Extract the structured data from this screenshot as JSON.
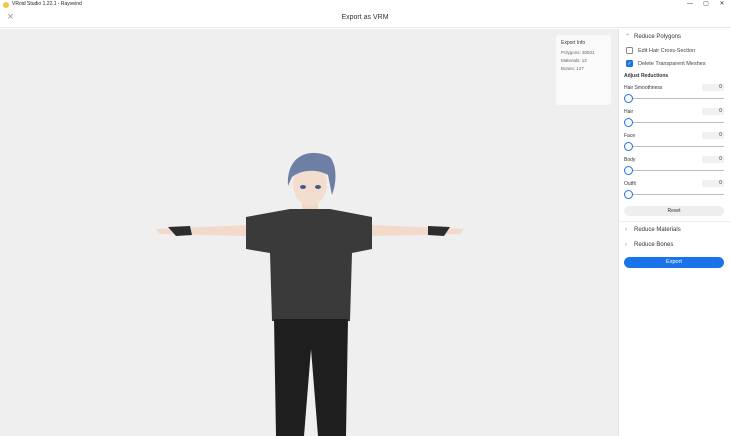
{
  "os": {
    "title": "VRoid Studio 1.22.1 - Rayveind",
    "minimize": "—",
    "maximize": "▢",
    "close": "✕"
  },
  "header": {
    "title": "Export as VRM",
    "close_icon": "×"
  },
  "export_info": {
    "title": "Export Info",
    "polygons": "Polygons: 30931",
    "materials": "Materials: 13",
    "bones": "Bones: 127"
  },
  "panel": {
    "reduce_polygons": "Reduce Polygons",
    "edit_hair": "Edit Hair Cross-Section",
    "delete_transparent": "Delete Transparent Meshes",
    "edit_hair_checked": false,
    "delete_transparent_checked": true,
    "adjust_reductions": "Adjust Reductions",
    "sliders": [
      {
        "label": "Hair Smoothness",
        "value": "0"
      },
      {
        "label": "Hair",
        "value": "0"
      },
      {
        "label": "Face",
        "value": "0"
      },
      {
        "label": "Body",
        "value": "0"
      },
      {
        "label": "Outfit",
        "value": "0"
      }
    ],
    "reset": "Reset",
    "reduce_materials": "Reduce Materials",
    "reduce_bones": "Reduce Bones",
    "export": "Export"
  },
  "colors": {
    "accent": "#1a73e8",
    "viewport_bg": "#efefef"
  }
}
